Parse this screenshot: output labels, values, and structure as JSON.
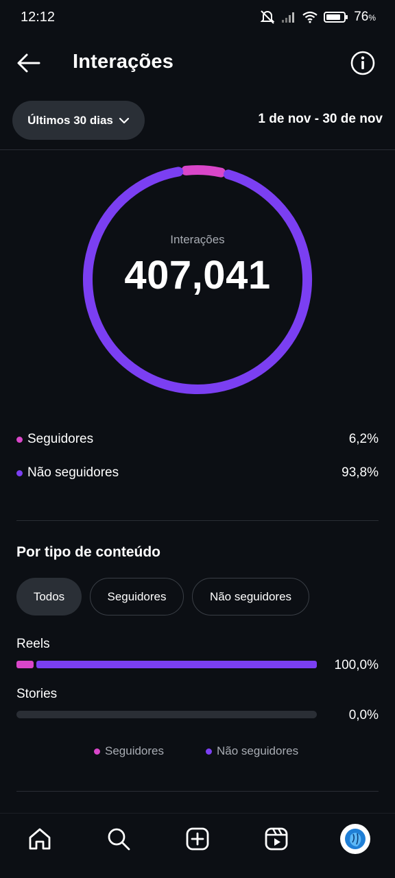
{
  "status_bar": {
    "time": "12:12",
    "battery": "76",
    "battery_unit": "%"
  },
  "header": {
    "title": "Interações"
  },
  "filter": {
    "range_label": "Últimos 30 dias",
    "date_range": "1 de nov - 30 de nov"
  },
  "summary": {
    "label": "Interações",
    "total": "407,041"
  },
  "audience": [
    {
      "label": "Seguidores",
      "value": "6,2%",
      "color": "#d946c9"
    },
    {
      "label": "Não seguidores",
      "value": "93,8%",
      "color": "#7b3ff2"
    }
  ],
  "chart_data": {
    "type": "pie",
    "categories": [
      "Seguidores",
      "Não seguidores"
    ],
    "values": [
      6.2,
      93.8
    ],
    "colors": [
      "#d946c9",
      "#7b3ff2"
    ],
    "title": "Interações"
  },
  "content_type": {
    "title": "Por tipo de conteúdo",
    "tabs": [
      "Todos",
      "Seguidores",
      "Não seguidores"
    ],
    "active_tab": "Todos",
    "rows": [
      {
        "label": "Reels",
        "value": "100,0%",
        "followers": 6.2,
        "non_followers": 93.8
      },
      {
        "label": "Stories",
        "value": "0,0%",
        "followers": 0,
        "non_followers": 0
      }
    ],
    "legend": [
      "Seguidores",
      "Não seguidores"
    ]
  },
  "nav": [
    "home-icon",
    "search-icon",
    "create-icon",
    "reels-icon",
    "profile-avatar"
  ]
}
